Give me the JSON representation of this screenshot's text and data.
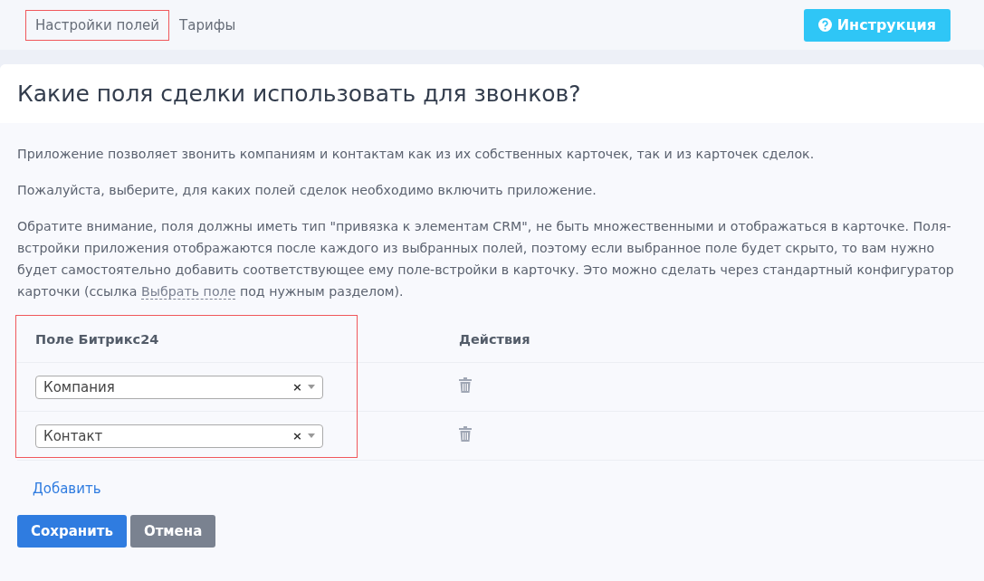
{
  "tabs": [
    {
      "label": "Настройки полей",
      "highlighted": true
    },
    {
      "label": "Тарифы",
      "highlighted": false
    }
  ],
  "help_button": {
    "label": "Инструкция"
  },
  "title": "Какие поля сделки использовать для звонков?",
  "paragraphs": [
    {
      "text": "Приложение позволяет звонить компаниям и контактам как из их собственных карточек, так и из карточек сделок."
    },
    {
      "text": "Пожалуйста, выберите, для каких полей сделок необходимо включить приложение."
    },
    {
      "text": "Обратите внимание, поля должны иметь тип \"привязка к элементам CRM\", не быть множественными и отображаться в карточке. Поля-встройки приложения отображаются после каждого из выбранных полей, поэтому если выбранное поле будет скрыто, то вам нужно будет самостоятельно добавить соответствующее ему поле-встройки в карточку. Это можно сделать через стандартный конфигуратор карточки (ссылка",
      "link": "Выбрать поле",
      "after": "под нужным разделом)."
    }
  ],
  "table": {
    "columns": [
      "Поле Битрикс24",
      "Действия"
    ],
    "field_column_highlighted": true,
    "rows": [
      {
        "value": "Компания",
        "clear": "×"
      },
      {
        "value": "Контакт",
        "clear": "×"
      }
    ]
  },
  "add_link": "Добавить",
  "buttons": [
    {
      "label": "Сохранить",
      "kind": "primary"
    },
    {
      "label": "Отмена",
      "kind": "secondary"
    }
  ]
}
